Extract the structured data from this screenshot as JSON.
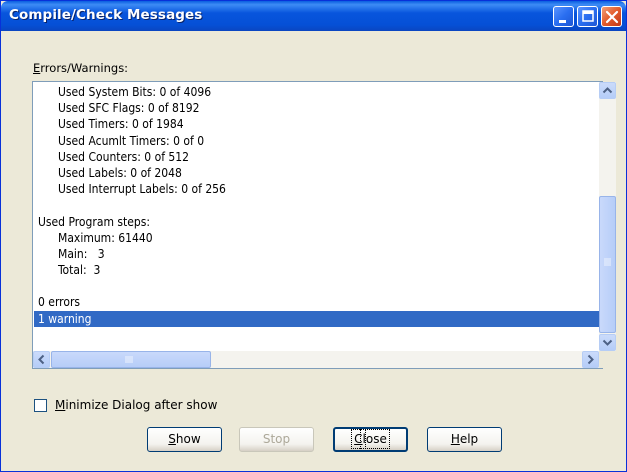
{
  "window": {
    "title": "Compile/Check Messages"
  },
  "errors_label": "Errors/Warnings:",
  "messages": [
    {
      "text": "Used System Bits: 0 of 4096",
      "indent": true
    },
    {
      "text": "Used SFC Flags: 0 of 8192",
      "indent": true
    },
    {
      "text": "Used Timers: 0 of 1984",
      "indent": true
    },
    {
      "text": "Used Acumlt Timers: 0 of 0",
      "indent": true
    },
    {
      "text": "Used Counters: 0 of 512",
      "indent": true
    },
    {
      "text": "Used Labels: 0 of 2048",
      "indent": true
    },
    {
      "text": "Used Interrupt Labels: 0 of 256",
      "indent": true
    },
    {
      "text": "",
      "indent": false
    },
    {
      "text": "Used Program steps:",
      "indent": false
    },
    {
      "text": "Maximum: 61440",
      "indent": true
    },
    {
      "text": "Main:   3",
      "indent": true
    },
    {
      "text": "Total:  3",
      "indent": true
    },
    {
      "text": "",
      "indent": false
    },
    {
      "text": "0 errors",
      "indent": false
    },
    {
      "text": "1 warning",
      "indent": false,
      "selected": true
    }
  ],
  "checkbox": {
    "label": "Minimize  Dialog after show",
    "checked": false
  },
  "buttons": {
    "show": "Show",
    "stop": "Stop",
    "close": "Close",
    "help": "Help"
  },
  "colors": {
    "selection": "#316ac5",
    "titlebar": "#0855dd"
  }
}
